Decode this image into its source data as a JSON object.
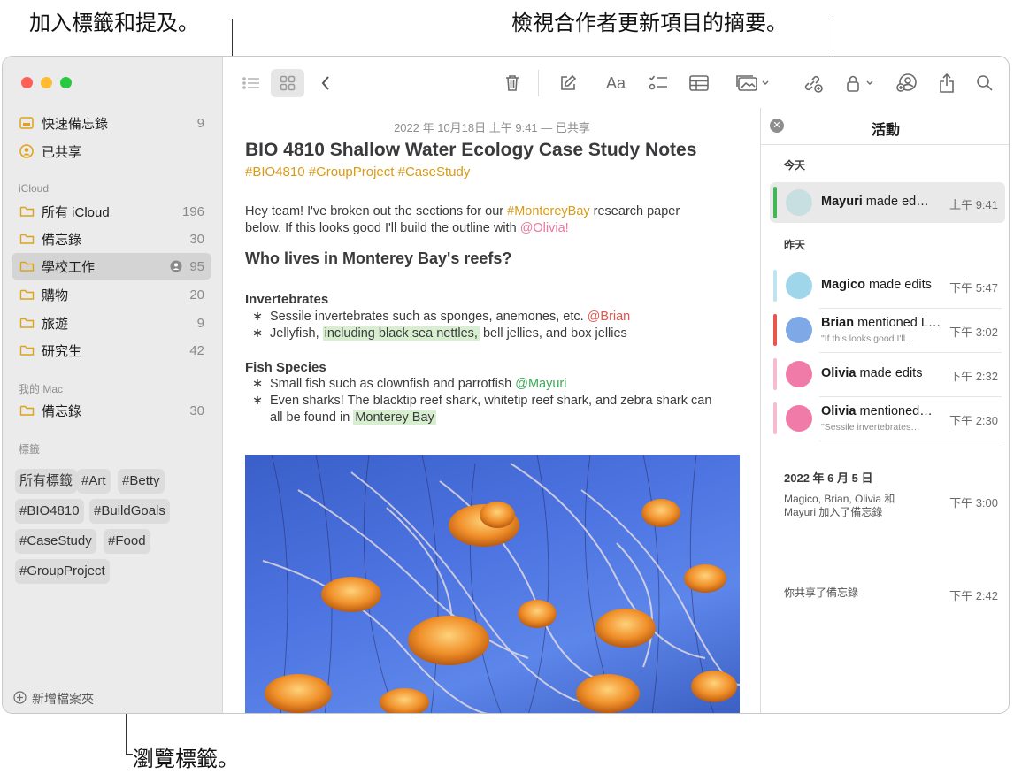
{
  "callouts": {
    "top_left": "加入標籤和提及。",
    "top_right": "檢視合作者更新項目的摘要。",
    "bottom": "瀏覽標籤。"
  },
  "sidebar": {
    "items_top": [
      {
        "label": "快速備忘錄",
        "count": "9",
        "icon": "quick-note-icon"
      },
      {
        "label": "已共享",
        "count": "",
        "icon": "shared-icon"
      }
    ],
    "icloud_section": "iCloud",
    "icloud_items": [
      {
        "label": "所有 iCloud",
        "count": "196"
      },
      {
        "label": "備忘錄",
        "count": "30"
      },
      {
        "label": "學校工作",
        "count": "95",
        "shared": true,
        "selected": true
      },
      {
        "label": "購物",
        "count": "20"
      },
      {
        "label": "旅遊",
        "count": "9"
      },
      {
        "label": "研究生",
        "count": "42"
      }
    ],
    "mac_section": "我的 Mac",
    "mac_items": [
      {
        "label": "備忘錄",
        "count": "30"
      }
    ],
    "tags_section": "標籤",
    "tags": [
      "所有標籤",
      "#Art",
      "#Betty",
      "#BIO4810",
      "#BuildGoals",
      "#CaseStudy",
      "#Food",
      "#GroupProject"
    ],
    "new_folder": "新增檔案夾"
  },
  "note": {
    "date": "2022 年 10月18日 上午 9:41 — 已共享",
    "title": "BIO 4810 Shallow Water Ecology Case Study Notes",
    "tags": "#BIO4810 #GroupProject #CaseStudy",
    "intro_1a": "Hey team! I've broken out the sections for our ",
    "intro_1_hash": "#MontereyBay",
    "intro_1b": " research paper",
    "intro_2a": "below. If this looks good I'll build the outline with ",
    "intro_2_mention": "@Olivia!",
    "heading": "Who lives in Monterey Bay's reefs?",
    "sub1": "Invertebrates",
    "b1a": "Sessile invertebrates such as sponges, anemones, etc. ",
    "b1_mention": "@Brian",
    "b2a": "Jellyfish, ",
    "b2_hl": "including black sea nettles,",
    "b2b": " bell jellies, and box jellies",
    "sub2": "Fish Species",
    "b3a": "Small fish such as clownfish and parrotfish ",
    "b3_mention": "@Mayuri",
    "b4a": "Even sharks! The blacktip reef shark, whitetip reef shark, and zebra shark can",
    "b4b": "all be found in ",
    "b4_hl": "Monterey Bay",
    "bullet_char": "∗"
  },
  "activity": {
    "title": "活動",
    "today": "今天",
    "yesterday": "昨天",
    "items_today": [
      {
        "name": "Mayuri",
        "action": " made ed…",
        "sub": "",
        "time": "上午 9:41",
        "bar": "#44b65a",
        "avatar": "#c8dfe2"
      }
    ],
    "items_yesterday": [
      {
        "name": "Magico",
        "action": " made edits",
        "sub": "",
        "time": "下午 5:47",
        "bar": "#bfe3f0",
        "avatar": "#9fd6ea"
      },
      {
        "name": "Brian",
        "action": " mentioned L…",
        "sub": "\"If this looks good I'll…",
        "time": "下午 3:02",
        "bar": "#e8554b",
        "avatar": "#7fa9e6"
      },
      {
        "name": "Olivia",
        "action": " made edits",
        "sub": "",
        "time": "下午 2:32",
        "bar": "#f3bcd0",
        "avatar": "#f07aa8"
      },
      {
        "name": "Olivia",
        "action": " mentioned…",
        "sub": "\"Sessile invertebrates…",
        "time": "下午 2:30",
        "bar": "#f3bcd0",
        "avatar": "#f07aa8"
      }
    ],
    "older_date": "2022 年 6 月 5 日",
    "older_1_line1": "Magico, Brian, Olivia 和",
    "older_1_line2": "Mayuri 加入了備忘錄",
    "older_1_time": "下午 3:00",
    "older_2": "你共享了備忘錄",
    "older_2_time": "下午 2:42"
  }
}
